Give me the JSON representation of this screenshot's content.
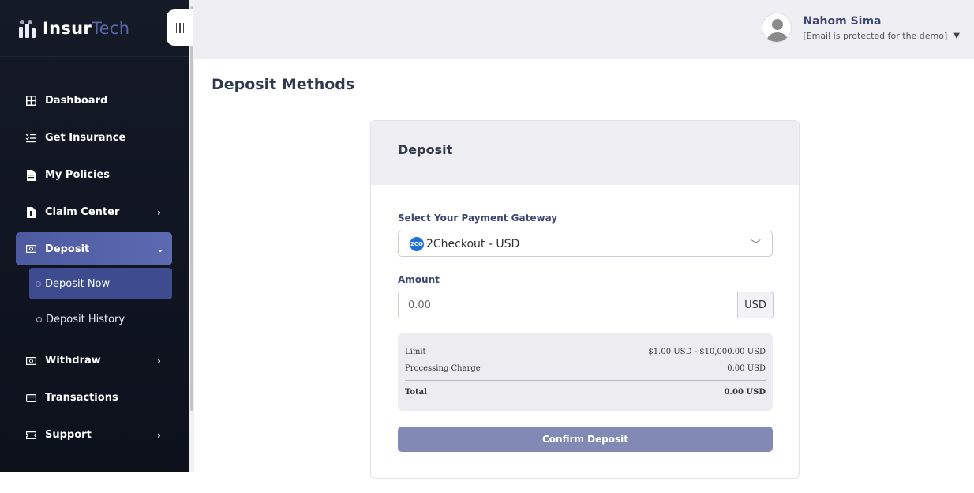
{
  "brand": {
    "name_main": "Insur",
    "name_accent": "Tech"
  },
  "sidebar": {
    "items": [
      {
        "label": "Dashboard",
        "icon": "grid-icon"
      },
      {
        "label": "Get Insurance",
        "icon": "list-check-icon"
      },
      {
        "label": "My Policies",
        "icon": "document-icon"
      },
      {
        "label": "Claim Center",
        "icon": "file-icon"
      },
      {
        "label": "Deposit",
        "icon": "money-icon"
      },
      {
        "label": "Withdraw",
        "icon": "money-icon"
      },
      {
        "label": "Transactions",
        "icon": "card-icon"
      },
      {
        "label": "Support",
        "icon": "ticket-icon"
      }
    ],
    "deposit_sub": [
      {
        "label": "Deposit Now"
      },
      {
        "label": "Deposit History"
      }
    ]
  },
  "user": {
    "name": "Nahom Sima",
    "email": "[Email is protected for the demo]"
  },
  "page": {
    "title": "Deposit Methods"
  },
  "card": {
    "title": "Deposit",
    "gateway_label": "Select Your Payment Gateway",
    "gateway_logo": "2CO",
    "gateway_value": "2Checkout - USD",
    "amount_label": "Amount",
    "amount_placeholder": "0.00",
    "currency": "USD",
    "summary": {
      "limit_label": "Limit",
      "limit_value": "$1.00 USD - $10,000.00 USD",
      "charge_label": "Processing Charge",
      "charge_value": "0.00 USD",
      "total_label": "Total",
      "total_value": "0.00 USD"
    },
    "confirm_label": "Confirm Deposit"
  },
  "colors": {
    "accent": "#4d5aa0",
    "sidebar_bg": "#141a26",
    "button": "#8389b5"
  }
}
